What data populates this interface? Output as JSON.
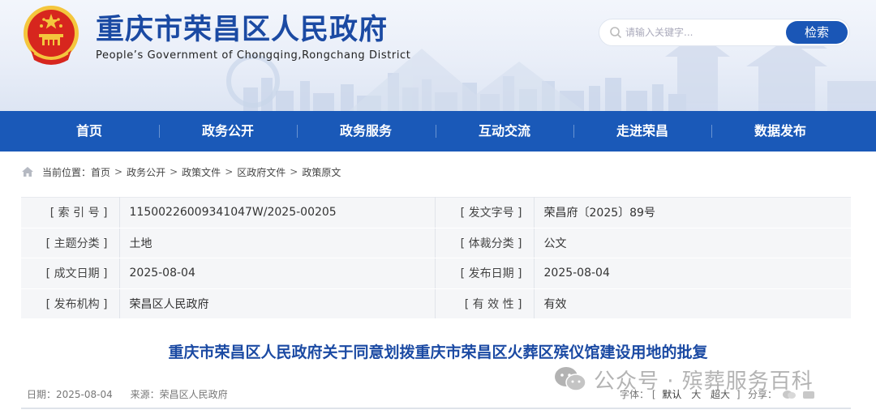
{
  "header": {
    "title": "重庆市荣昌区人民政府",
    "subtitle": "People’s Government of Chongqing,Rongchang District",
    "search": {
      "placeholder": "请输入关键字...",
      "button": "检索"
    }
  },
  "nav": {
    "items": [
      "首页",
      "政务公开",
      "政务服务",
      "互动交流",
      "走进荣昌",
      "数据发布"
    ]
  },
  "breadcrumb": {
    "prefix": "当前位置：",
    "items": [
      "首页",
      "政务公开",
      "政策文件",
      "区政府文件",
      "政策原文"
    ],
    "separator": ">"
  },
  "info": {
    "rows": [
      {
        "label1": "[ 索 引 号 ]",
        "value1": "11500226009341047W/2025-00205",
        "label2": "[ 发文字号 ]",
        "value2": "荣昌府〔2025〕89号"
      },
      {
        "label1": "[ 主题分类 ]",
        "value1": "土地",
        "label2": "[ 体裁分类 ]",
        "value2": "公文"
      },
      {
        "label1": "[ 成文日期 ]",
        "value1": "2025-08-04",
        "label2": "[ 发布日期 ]",
        "value2": "2025-08-04"
      },
      {
        "label1": "[ 发布机构 ]",
        "value1": "荣昌区人民政府",
        "label2": "[ 有 效 性 ]",
        "value2": "有效"
      }
    ]
  },
  "article": {
    "title": "重庆市荣昌区人民政府关于同意划拨重庆市荣昌区火葬区殡仪馆建设用地的批复",
    "date": "日期：2025-08-04",
    "source": "来源：荣昌区人民政府",
    "font_label": "字体：",
    "font_open": "[",
    "font_options": [
      "默认",
      "大",
      "超大"
    ],
    "font_close": "]",
    "share_label": "分享："
  },
  "watermark": {
    "text": "公众号 · 殡葬服务百科"
  },
  "colors": {
    "brand": "#1a59b8",
    "title": "#1b4aa3",
    "emblem_red": "#d7261e",
    "emblem_gold": "#f4c63d"
  },
  "icons": [
    "national-emblem-icon",
    "search-icon",
    "home-icon",
    "wechat-icon",
    "share-icon"
  ]
}
